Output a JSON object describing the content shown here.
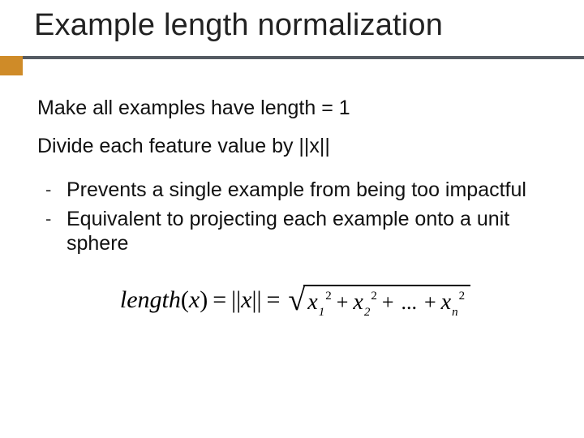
{
  "title": "Example length normalization",
  "body": {
    "line1": "Make all examples have length = 1",
    "line2": "Divide each feature value by ||x||",
    "bullets": [
      "Prevents a single example from being too impactful",
      "Equivalent to projecting each example onto a unit sphere"
    ]
  },
  "formula": {
    "lhs_word": "length",
    "lhs_arg": "x",
    "mid": "x",
    "terms": [
      {
        "base": "x",
        "sub": "1",
        "sup": "2"
      },
      {
        "base": "x",
        "sub": "2",
        "sup": "2"
      }
    ],
    "dots": "...",
    "last": {
      "base": "x",
      "sub": "n",
      "sup": "2"
    }
  }
}
